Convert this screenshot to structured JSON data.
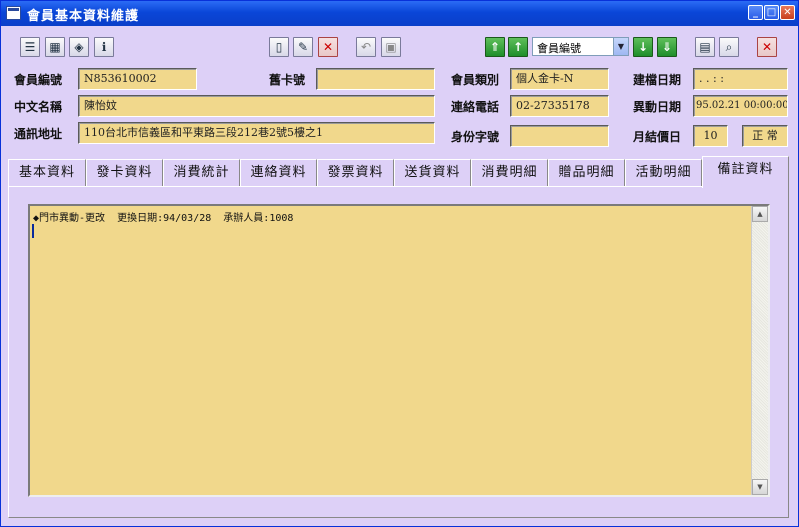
{
  "window": {
    "title": "會員基本資料維護"
  },
  "title_buttons": {
    "minimize": "_",
    "maximize": "□",
    "close": "✕"
  },
  "toolbar": {
    "left_tools": [
      "list-icon",
      "calendar-icon",
      "book-icon",
      "info-icon"
    ],
    "doc_tools": [
      "new-document-icon",
      "edit-icon",
      "delete-icon"
    ],
    "dim_tools": [
      "undo-icon",
      "save-icon"
    ],
    "nav_first": "⇑",
    "nav_prev": "↑",
    "sort_combo": "會員編號",
    "nav_next": "↓",
    "nav_last": "⇓",
    "right_tools": [
      "grid-icon",
      "search-icon",
      "close-icon"
    ]
  },
  "form": {
    "member_no_label": "會員編號",
    "member_no": "N853610002",
    "old_card_label": "舊卡號",
    "old_card": "",
    "member_type_label": "會員類別",
    "member_type": "個人金卡-N",
    "created_label": "建檔日期",
    "created": " . .  : :",
    "chinese_name_label": "中文名稱",
    "chinese_name": "陳怡妏",
    "phone_label": "連絡電話",
    "phone": "02-27335178",
    "changed_label": "異動日期",
    "changed": "95.02.21 00:00:00",
    "address_label": "通訊地址",
    "address": "110台北市信義區和平東路三段212巷2號5樓之1",
    "id_label": "身份字號",
    "id_no": "",
    "month_settle_label": "月結價日",
    "month_settle": "10",
    "status": "正  常"
  },
  "tabs": [
    "基本資料",
    "發卡資料",
    "消費統計",
    "連絡資料",
    "發票資料",
    "送貨資料",
    "消費明細",
    "贈品明細",
    "活動明細",
    "備註資料"
  ],
  "active_tab": "備註資料",
  "memo": {
    "text": "◆門市異動-更改  更換日期:94/03/28  承辦人員:1008"
  },
  "colors": {
    "field_bg": "#f1d88c",
    "window_bg": "#ddd0f7",
    "title_bar": "#0a46d8"
  }
}
